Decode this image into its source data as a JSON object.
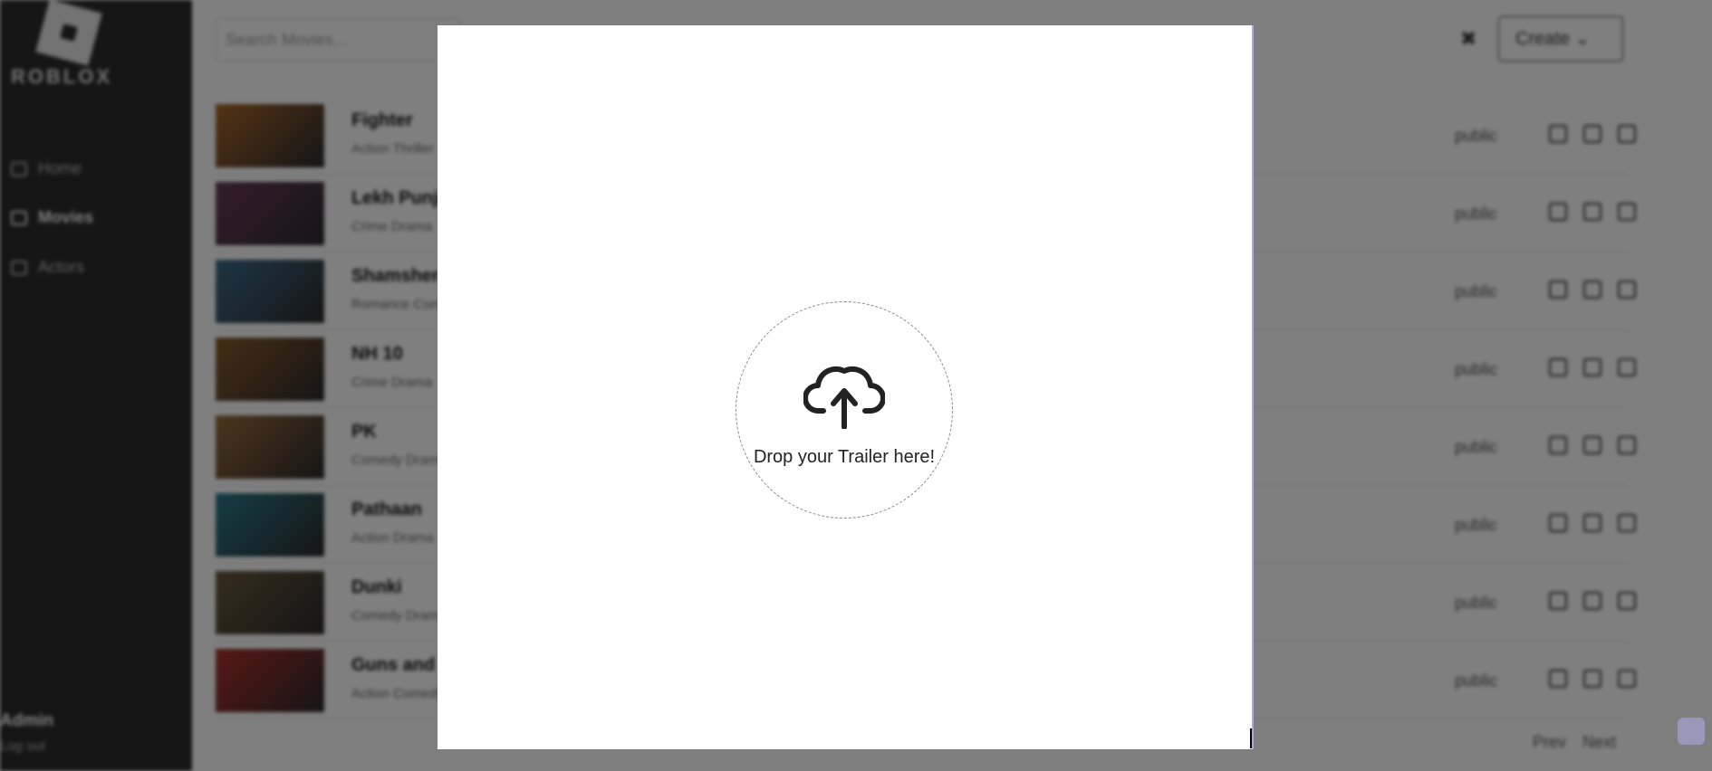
{
  "brand": {
    "logo_text": "ROBLOX"
  },
  "sidebar": {
    "items": [
      {
        "label": "Home",
        "icon": "home-icon"
      },
      {
        "label": "Movies",
        "icon": "film-icon"
      },
      {
        "label": "Actors",
        "icon": "user-icon"
      }
    ],
    "admin_name": "Admin",
    "logout_label": "Log out"
  },
  "header": {
    "search_placeholder": "Search Movies...",
    "close_symbol": "✖",
    "create_label": "Create ⌄"
  },
  "movies": [
    {
      "title": "Fighter",
      "genre": "Action Thriller",
      "status": "public",
      "thumb": "#a8652a"
    },
    {
      "title": "Lekh Punjabi",
      "genre": "Crime Drama",
      "status": "public",
      "thumb": "#6a3a5a"
    },
    {
      "title": "Shamshera",
      "genre": "Romance Comedy",
      "status": "public",
      "thumb": "#3c6c8a"
    },
    {
      "title": "NH 10",
      "genre": "Crime Drama",
      "status": "public",
      "thumb": "#8a5a28"
    },
    {
      "title": "PK",
      "genre": "Comedy Drama",
      "status": "public",
      "thumb": "#9a6a3a"
    },
    {
      "title": "Pathaan",
      "genre": "Action Drama",
      "status": "public",
      "thumb": "#2a7a8a"
    },
    {
      "title": "Dunki",
      "genre": "Comedy Drama",
      "status": "public",
      "thumb": "#6a5a3a"
    },
    {
      "title": "Guns and Gulaabs",
      "genre": "Action Comedy",
      "status": "public",
      "thumb": "#b0302a"
    }
  ],
  "pagination": {
    "prev": "Prev",
    "next": "Next"
  },
  "modal": {
    "drop_label": "Drop your Trailer here!"
  }
}
